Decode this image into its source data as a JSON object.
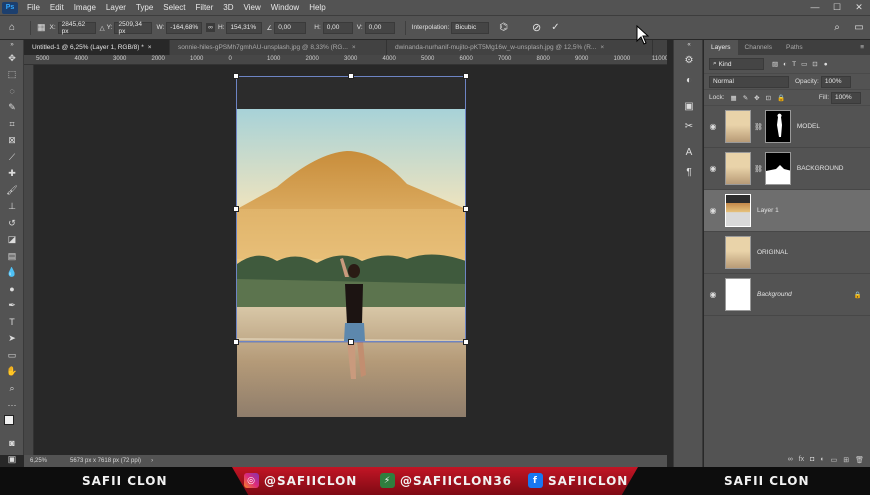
{
  "menu": {
    "app_logo": "Ps",
    "items": [
      "File",
      "Edit",
      "Image",
      "Layer",
      "Type",
      "Select",
      "Filter",
      "3D",
      "View",
      "Window",
      "Help"
    ],
    "window_controls": [
      "—",
      "☐",
      "✕"
    ]
  },
  "options": {
    "x_label": "X:",
    "x_value": "2845,62 px",
    "y_label": "Y:",
    "y_value": "2509,34 px",
    "w_label": "W:",
    "w_value": "-164,68%",
    "h_label": "H:",
    "h_value": "154,31%",
    "angle_value": "0,00",
    "hskew_label": "H:",
    "hskew_value": "0,00",
    "vskew_label": "V:",
    "vskew_value": "0,00",
    "interp_label": "Interpolation:",
    "interp_value": "Bicubic"
  },
  "tabs": [
    {
      "label": "Untitled-1 @ 6,25% (Layer 1, RGB/8) *",
      "active": true
    },
    {
      "label": "sonnie-hiles-gPSMh7gmhAU-unsplash.jpg @ 8,33% (RG...",
      "active": false
    },
    {
      "label": "dwinanda-nurhanif-mujito-pKT5Mg16w_w-unsplash.jpg @ 12,5% (R...",
      "active": false
    }
  ],
  "ruler": [
    "5000",
    "4000",
    "3000",
    "2000",
    "1000",
    "0",
    "1000",
    "2000",
    "3000",
    "4000",
    "5000",
    "6000",
    "7000",
    "8000",
    "9000",
    "10000",
    "11000"
  ],
  "status": {
    "zoom": "6,25%",
    "doc_info": "5673 px x 7618 px (72 ppi)"
  },
  "panel": {
    "tabs": [
      "Layers",
      "Channels",
      "Paths"
    ],
    "kind_label": "Kind",
    "blend_mode": "Normal",
    "opacity_label": "Opacity:",
    "opacity_value": "100%",
    "lock_label": "Lock:",
    "fill_label": "Fill:",
    "fill_value": "100%",
    "layers": [
      {
        "name": "MODEL",
        "visible": true,
        "has_mask": true,
        "selected": false
      },
      {
        "name": "BACKGROUND",
        "visible": true,
        "has_mask": true,
        "selected": false
      },
      {
        "name": "Layer 1",
        "visible": true,
        "has_mask": false,
        "selected": true
      },
      {
        "name": "ORIGINAL",
        "visible": false,
        "has_mask": false,
        "selected": false
      },
      {
        "name": "Background",
        "visible": true,
        "has_mask": false,
        "selected": false
      }
    ]
  },
  "banner": {
    "left": "SAFII CLON",
    "instagram": "@SAFIICLON",
    "gamejolt": "@SAFIICLON36",
    "facebook": "SAFIICLON",
    "right": "SAFII CLON"
  },
  "colors": {
    "accent_red": "#c21525",
    "ui_dark": "#535353",
    "canvas": "#282828"
  }
}
